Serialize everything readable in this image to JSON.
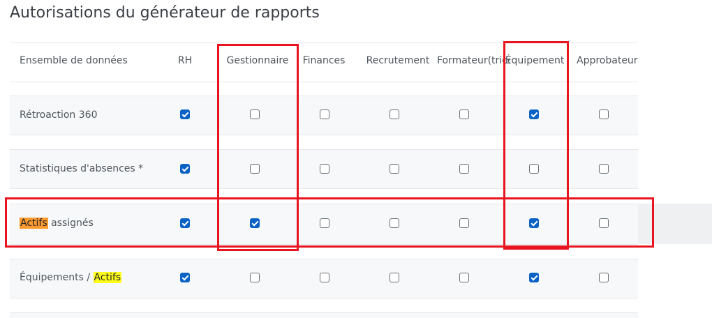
{
  "page": {
    "title": "Autorisations du générateur de rapports"
  },
  "table": {
    "columns": [
      {
        "key": "dataset",
        "label": "Ensemble de données"
      },
      {
        "key": "rh",
        "label": "RH"
      },
      {
        "key": "gestionnaire",
        "label": "Gestionnaire"
      },
      {
        "key": "finances",
        "label": "Finances"
      },
      {
        "key": "recrutement",
        "label": "Recrutement"
      },
      {
        "key": "formateur",
        "label": "Formateur(trice)"
      },
      {
        "key": "equipement",
        "label": "Équipement"
      },
      {
        "key": "approbateur",
        "label": "Approbateur"
      }
    ],
    "rows": [
      {
        "label": "Rétroaction 360",
        "checks": [
          true,
          false,
          false,
          false,
          false,
          true,
          false
        ]
      },
      {
        "label": "Statistiques d'absences *",
        "checks": [
          true,
          false,
          false,
          false,
          false,
          false,
          false
        ]
      },
      {
        "label_highlight": "Actifs",
        "label_rest": " assignés",
        "checks": [
          true,
          true,
          false,
          false,
          false,
          true,
          false
        ]
      },
      {
        "label_prefix": "Équipements / ",
        "label_highlight": "Actifs",
        "checks": [
          true,
          false,
          false,
          false,
          false,
          true,
          false
        ]
      }
    ]
  },
  "annotations": {
    "box_color": "#e8141f",
    "highlight_orange": "#ff9a2e",
    "highlight_yellow": "#ffff1a",
    "checkbox_checked_color": "#0a62c4"
  }
}
